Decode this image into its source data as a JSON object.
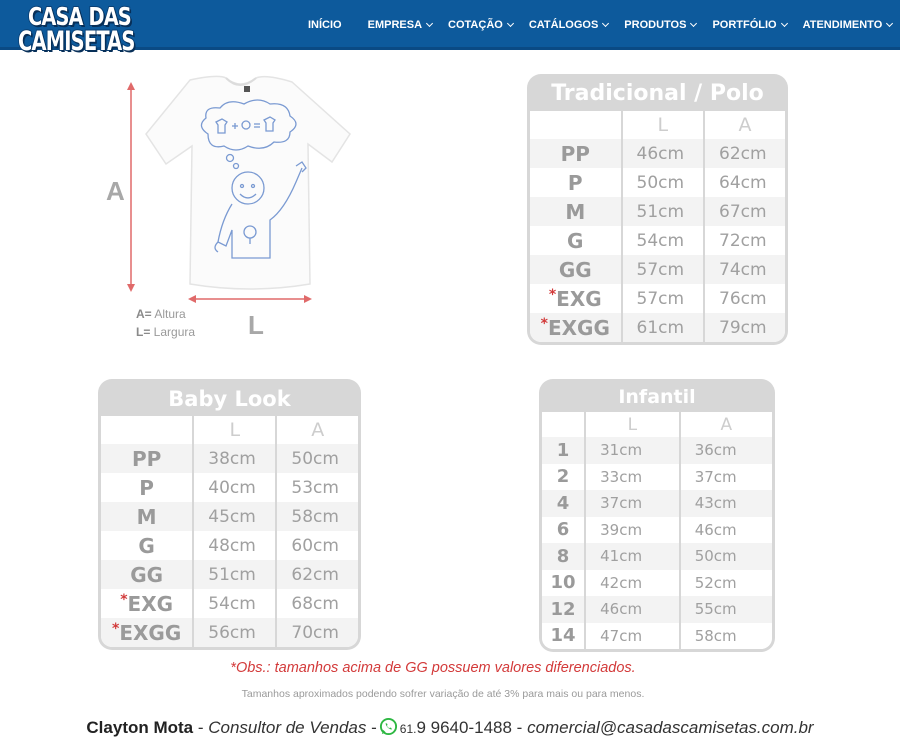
{
  "header": {
    "logo": {
      "line1": "CASA DAS",
      "line2": "CAMISETAS"
    },
    "nav": [
      {
        "label": "INÍCIO",
        "has_dropdown": false
      },
      {
        "label": "EMPRESA",
        "has_dropdown": true
      },
      {
        "label": "COTAÇÃO",
        "has_dropdown": true
      },
      {
        "label": "CATÁLOGOS",
        "has_dropdown": true
      },
      {
        "label": "PRODUTOS",
        "has_dropdown": true
      },
      {
        "label": "PORTFÓLIO",
        "has_dropdown": true
      },
      {
        "label": "ATENDIMENTO",
        "has_dropdown": true
      }
    ],
    "colors": {
      "bar": "#0d5a9c",
      "text": "#ffffff"
    }
  },
  "shirt": {
    "dim_a": "A",
    "dim_l": "L",
    "legend": [
      {
        "key": "A=",
        "text": " Altura"
      },
      {
        "key": "L=",
        "text": " Largura"
      }
    ]
  },
  "tables": {
    "tradicional": {
      "title": "Tradicional  /  Polo",
      "headers": [
        "",
        "L",
        "A"
      ],
      "rows": [
        {
          "size": "PP",
          "star": "",
          "l": "46cm",
          "a": "62cm"
        },
        {
          "size": "P",
          "star": "",
          "l": "50cm",
          "a": "64cm"
        },
        {
          "size": "M",
          "star": "",
          "l": "51cm",
          "a": "67cm"
        },
        {
          "size": "G",
          "star": "",
          "l": "54cm",
          "a": "72cm"
        },
        {
          "size": "GG",
          "star": "",
          "l": "57cm",
          "a": "74cm"
        },
        {
          "size": "EXG",
          "star": "*",
          "l": "57cm",
          "a": "76cm"
        },
        {
          "size": "EXGG",
          "star": "*",
          "l": "61cm",
          "a": "79cm"
        }
      ]
    },
    "baby_look": {
      "title": "Baby Look",
      "headers": [
        "",
        "L",
        "A"
      ],
      "rows": [
        {
          "size": "PP",
          "star": "",
          "l": "38cm",
          "a": "50cm"
        },
        {
          "size": "P",
          "star": "",
          "l": "40cm",
          "a": "53cm"
        },
        {
          "size": "M",
          "star": "",
          "l": "45cm",
          "a": "58cm"
        },
        {
          "size": "G",
          "star": "",
          "l": "48cm",
          "a": "60cm"
        },
        {
          "size": "GG",
          "star": "",
          "l": "51cm",
          "a": "62cm"
        },
        {
          "size": "EXG",
          "star": "*",
          "l": "54cm",
          "a": "68cm"
        },
        {
          "size": "EXGG",
          "star": "*",
          "l": "56cm",
          "a": "70cm"
        }
      ]
    },
    "infantil": {
      "title": "Infantil",
      "headers": [
        "",
        "L",
        "A"
      ],
      "rows": [
        {
          "size": "1",
          "star": "",
          "l": "31cm",
          "a": "36cm"
        },
        {
          "size": "2",
          "star": "",
          "l": "33cm",
          "a": "37cm"
        },
        {
          "size": "4",
          "star": "",
          "l": "37cm",
          "a": "43cm"
        },
        {
          "size": "6",
          "star": "",
          "l": "39cm",
          "a": "46cm"
        },
        {
          "size": "8",
          "star": "",
          "l": "41cm",
          "a": "50cm"
        },
        {
          "size": "10",
          "star": "",
          "l": "42cm",
          "a": "52cm"
        },
        {
          "size": "12",
          "star": "",
          "l": "46cm",
          "a": "55cm"
        },
        {
          "size": "14",
          "star": "",
          "l": "47cm",
          "a": "58cm"
        }
      ]
    }
  },
  "footer": {
    "obs": "*Obs.: tamanhos acima de GG possuem valores diferenciados.",
    "note": "Tamanhos aproximados podendo sofrer variação de até 3% para mais ou para menos.",
    "contact": {
      "name": "Clayton Mota",
      "sep1": " - ",
      "role": "Consultor de Vendas",
      "sep2": " -",
      "phone_ddd": "61.",
      "phone": "9 9640-1488",
      "sep3": " - ",
      "email": "comercial@casadascamisetas.com.br"
    }
  }
}
